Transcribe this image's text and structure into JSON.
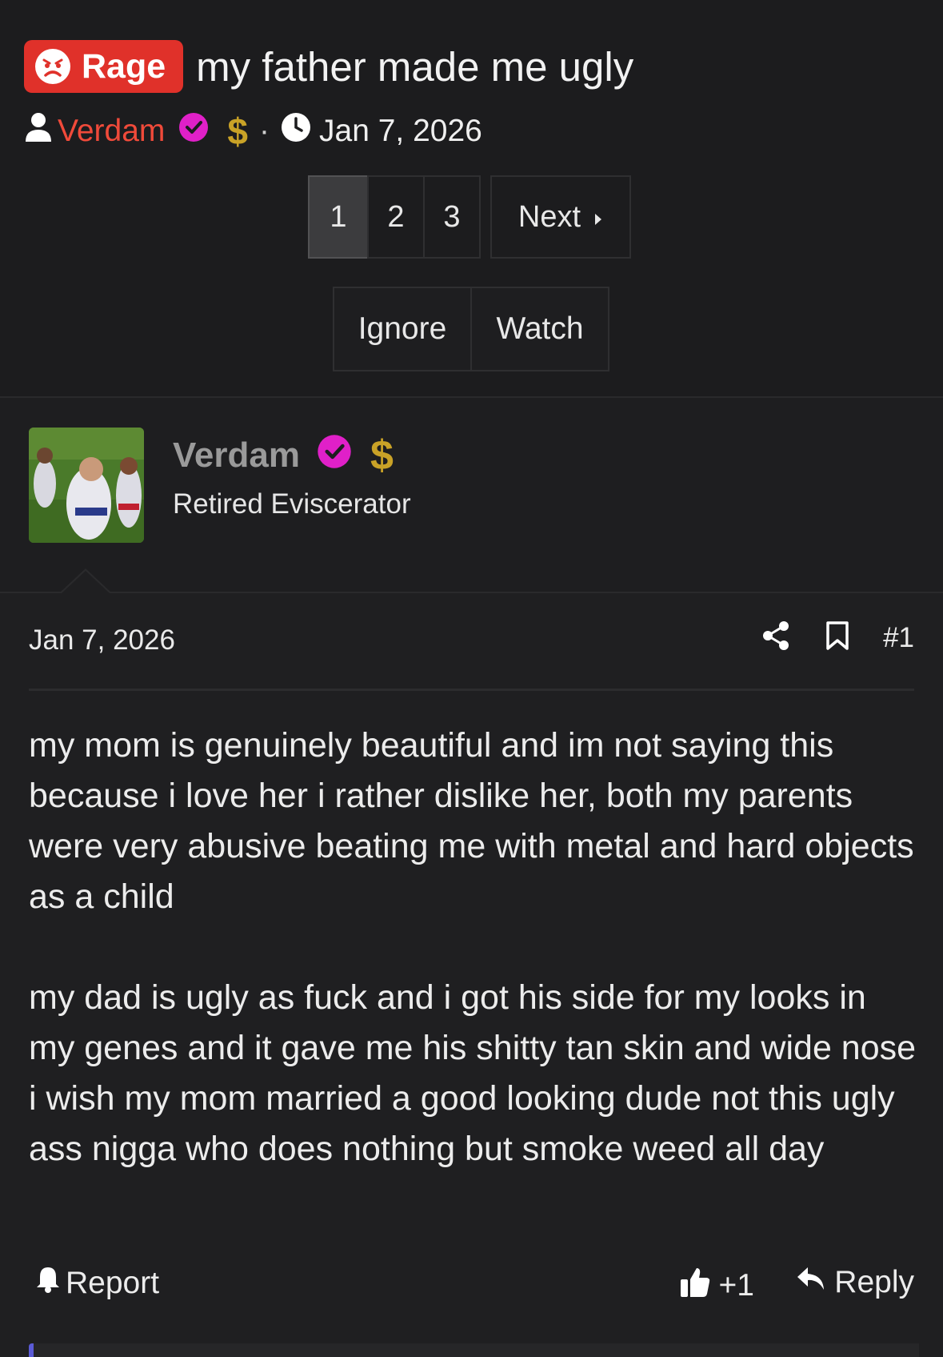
{
  "thread": {
    "prefix": "Rage",
    "title": "my father made me ugly",
    "author": "Verdam",
    "date": "Jan 7, 2026"
  },
  "pagination": {
    "pages": [
      "1",
      "2",
      "3"
    ],
    "active": "1",
    "next_label": "Next"
  },
  "actions": {
    "ignore_label": "Ignore",
    "watch_label": "Watch"
  },
  "post": {
    "username": "Verdam",
    "user_title": "Retired Eviscerator",
    "date": "Jan 7, 2026",
    "number": "#1",
    "paragraphs": [
      "my mom is genuinely beautiful and im not saying this because i love her i rather dislike her, both my parents were very abusive beating me with metal and hard objects as a child",
      "my dad is ugly as fuck and i got his side for my looks in my genes and it gave me his shitty tan skin and wide nose i wish my mom married a good looking dude not this ugly ass nigga who does nothing but smoke weed all day"
    ],
    "report_label": "Report",
    "reaction_label": "+1",
    "reply_label": "Reply"
  },
  "colors": {
    "prefix_bg": "#e0312a",
    "username": "#f04a3a",
    "verified_badge": "#e020c8",
    "dollar_badge": "#c9a227",
    "background": "#1f1f21"
  },
  "icons": [
    "angry-face-icon",
    "user-icon",
    "verified-badge-icon",
    "dollar-icon",
    "clock-icon",
    "caret-right-icon",
    "share-icon",
    "bookmark-icon",
    "bell-icon",
    "thumbs-up-icon",
    "reply-arrow-icon"
  ]
}
